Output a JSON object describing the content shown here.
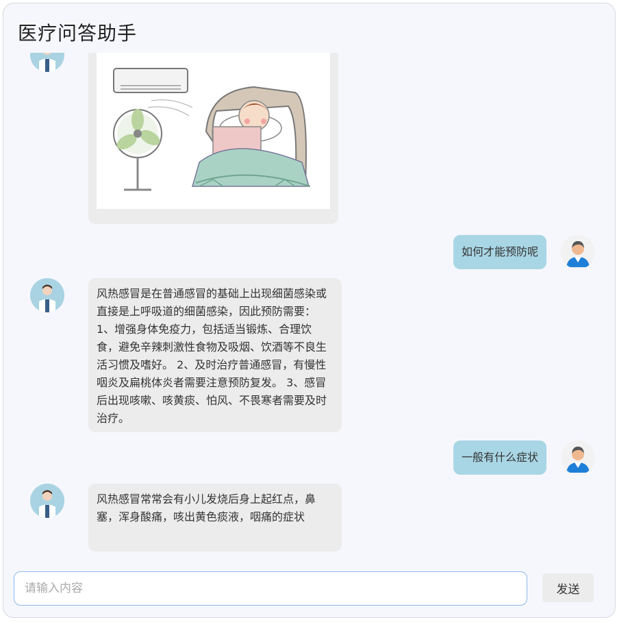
{
  "app": {
    "title": "医疗问答助手"
  },
  "messages": [
    {
      "role": "bot",
      "type": "image",
      "image": "illustration-sick-child-in-bed-fan-air-conditioner"
    },
    {
      "role": "user",
      "text": "如何才能预防呢"
    },
    {
      "role": "bot",
      "text": "风热感冒是在普通感冒的基础上出现细菌感染或直接是上呼吸道的细菌感染，因此预防需要： 1、增强身体免疫力，包括适当锻炼、合理饮食，避免辛辣刺激性食物及吸烟、饮酒等不良生活习惯及嗜好。 2、及时治疗普通感冒，有慢性咽炎及扁桃体炎者需要注意预防复发。 3、感冒后出现咳嗽、咳黄痰、怕风、不畏寒者需要及时治疗。"
    },
    {
      "role": "user",
      "text": "一般有什么症状"
    },
    {
      "role": "bot",
      "text": "风热感冒常常会有小儿发烧后身上起红点，鼻塞，浑身酸痛，咳出黄色痰液，咽痛的症状"
    }
  ],
  "input": {
    "placeholder": "请输入内容",
    "value": ""
  },
  "send_button": {
    "label": "发送"
  },
  "colors": {
    "user_bubble": "#a9d6e5",
    "bot_bubble": "#ececec",
    "background": "#f6f7fd"
  }
}
